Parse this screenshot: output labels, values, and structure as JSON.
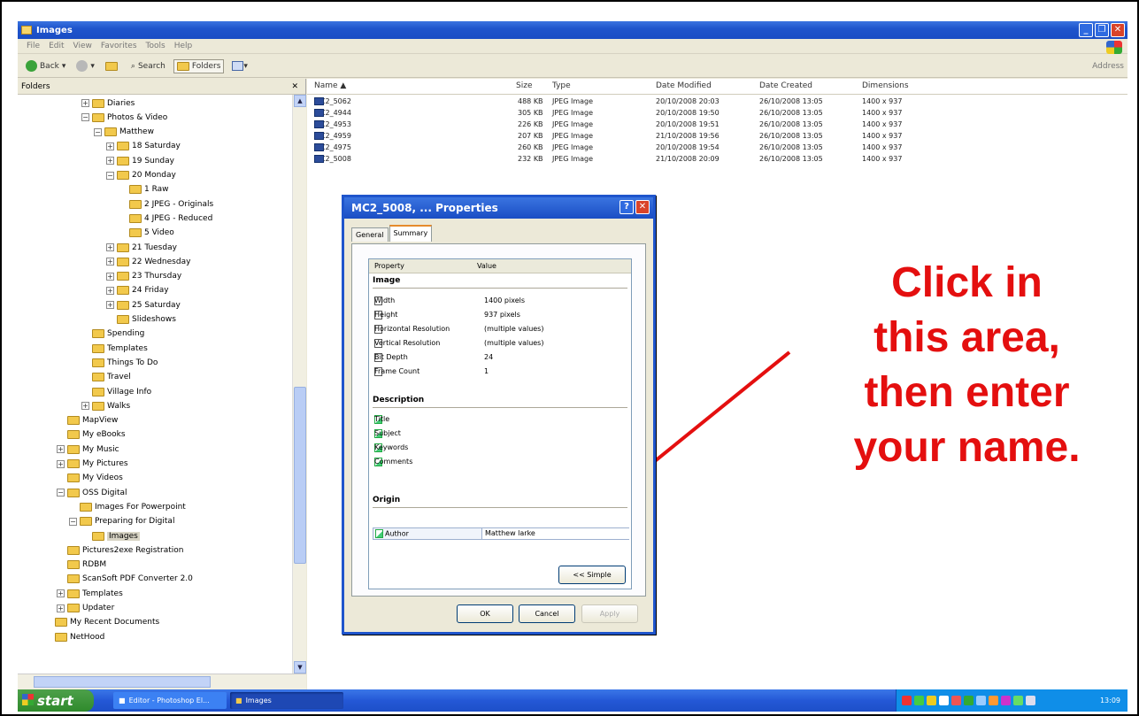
{
  "window": {
    "title": "Images"
  },
  "menu": [
    "File",
    "Edit",
    "View",
    "Favorites",
    "Tools",
    "Help"
  ],
  "toolbar": {
    "back": "Back",
    "search": "Search",
    "folders": "Folders",
    "address": "Address"
  },
  "folders_pane": {
    "title": "Folders",
    "tree": [
      {
        "label": "Diaries",
        "indent": 5,
        "exp": "+"
      },
      {
        "label": "Photos & Video",
        "indent": 5,
        "exp": "−"
      },
      {
        "label": "Matthew",
        "indent": 6,
        "exp": "−"
      },
      {
        "label": "18 Saturday",
        "indent": 7,
        "exp": "+"
      },
      {
        "label": "19 Sunday",
        "indent": 7,
        "exp": "+"
      },
      {
        "label": "20 Monday",
        "indent": 7,
        "exp": "−"
      },
      {
        "label": "1 Raw",
        "indent": 8,
        "exp": ""
      },
      {
        "label": "2 JPEG - Originals",
        "indent": 8,
        "exp": ""
      },
      {
        "label": "4 JPEG - Reduced",
        "indent": 8,
        "exp": ""
      },
      {
        "label": "5 Video",
        "indent": 8,
        "exp": ""
      },
      {
        "label": "21 Tuesday",
        "indent": 7,
        "exp": "+"
      },
      {
        "label": "22 Wednesday",
        "indent": 7,
        "exp": "+"
      },
      {
        "label": "23 Thursday",
        "indent": 7,
        "exp": "+"
      },
      {
        "label": "24 Friday",
        "indent": 7,
        "exp": "+"
      },
      {
        "label": "25 Saturday",
        "indent": 7,
        "exp": "+"
      },
      {
        "label": "Slideshows",
        "indent": 7,
        "exp": ""
      },
      {
        "label": "Spending",
        "indent": 5,
        "exp": ""
      },
      {
        "label": "Templates",
        "indent": 5,
        "exp": ""
      },
      {
        "label": "Things To Do",
        "indent": 5,
        "exp": ""
      },
      {
        "label": "Travel",
        "indent": 5,
        "exp": ""
      },
      {
        "label": "Village Info",
        "indent": 5,
        "exp": ""
      },
      {
        "label": "Walks",
        "indent": 5,
        "exp": "+"
      },
      {
        "label": "MapView",
        "indent": 3,
        "exp": ""
      },
      {
        "label": "My eBooks",
        "indent": 3,
        "exp": ""
      },
      {
        "label": "My Music",
        "indent": 3,
        "exp": "+"
      },
      {
        "label": "My Pictures",
        "indent": 3,
        "exp": "+"
      },
      {
        "label": "My Videos",
        "indent": 3,
        "exp": ""
      },
      {
        "label": "OSS Digital",
        "indent": 3,
        "exp": "−"
      },
      {
        "label": "Images For Powerpoint",
        "indent": 4,
        "exp": ""
      },
      {
        "label": "Preparing for Digital",
        "indent": 4,
        "exp": "−"
      },
      {
        "label": "Images",
        "indent": 5,
        "exp": "",
        "selected": true
      },
      {
        "label": "Pictures2exe Registration",
        "indent": 3,
        "exp": ""
      },
      {
        "label": "RDBM",
        "indent": 3,
        "exp": ""
      },
      {
        "label": "ScanSoft PDF Converter 2.0",
        "indent": 3,
        "exp": ""
      },
      {
        "label": "Templates",
        "indent": 3,
        "exp": "+"
      },
      {
        "label": "Updater",
        "indent": 3,
        "exp": "+"
      },
      {
        "label": "My Recent Documents",
        "indent": 2,
        "exp": ""
      },
      {
        "label": "NetHood",
        "indent": 2,
        "exp": ""
      }
    ]
  },
  "file_list": {
    "columns": [
      "Name ▲",
      "Size",
      "Type",
      "Date Modified",
      "Date Created",
      "Dimensions"
    ],
    "rows": [
      [
        "MC2_5062",
        "488 KB",
        "JPEG Image",
        "20/10/2008 20:03",
        "26/10/2008 13:05",
        "1400 x 937"
      ],
      [
        "MC2_4944",
        "305 KB",
        "JPEG Image",
        "20/10/2008 19:50",
        "26/10/2008 13:05",
        "1400 x 937"
      ],
      [
        "MC2_4953",
        "226 KB",
        "JPEG Image",
        "20/10/2008 19:51",
        "26/10/2008 13:05",
        "1400 x 937"
      ],
      [
        "MC2_4959",
        "207 KB",
        "JPEG Image",
        "21/10/2008 19:56",
        "26/10/2008 13:05",
        "1400 x 937"
      ],
      [
        "MC2_4975",
        "260 KB",
        "JPEG Image",
        "20/10/2008 19:54",
        "26/10/2008 13:05",
        "1400 x 937"
      ],
      [
        "MC2_5008",
        "232 KB",
        "JPEG Image",
        "21/10/2008 20:09",
        "26/10/2008 13:05",
        "1400 x 937"
      ]
    ]
  },
  "dialog": {
    "title": "MC2_5008, ... Properties",
    "help": "?",
    "close": "✕",
    "tabs": [
      "General",
      "Summary"
    ],
    "header_property": "Property",
    "header_value": "Value",
    "sections": {
      "image": "Image",
      "description": "Description",
      "origin": "Origin"
    },
    "image_props": [
      [
        "Width",
        "1400 pixels"
      ],
      [
        "Height",
        "937 pixels"
      ],
      [
        "Horizontal Resolution",
        "(multiple values)"
      ],
      [
        "Vertical Resolution",
        "(multiple values)"
      ],
      [
        "Bit Depth",
        "24"
      ],
      [
        "Frame Count",
        "1"
      ]
    ],
    "description_props": [
      "Title",
      "Subject",
      "Keywords",
      "Comments"
    ],
    "author_label": "Author",
    "author_value": "Matthew larke",
    "simple_button": "<< Simple",
    "ok": "OK",
    "cancel": "Cancel",
    "apply": "Apply"
  },
  "annotation": {
    "lines": [
      "Click in",
      "this area,",
      "then enter",
      "your name."
    ],
    "color": "#e40f0f"
  },
  "taskbar": {
    "start": "start",
    "tasks": [
      "Editor - Photoshop El...",
      "Images"
    ],
    "clock": "13:09"
  }
}
